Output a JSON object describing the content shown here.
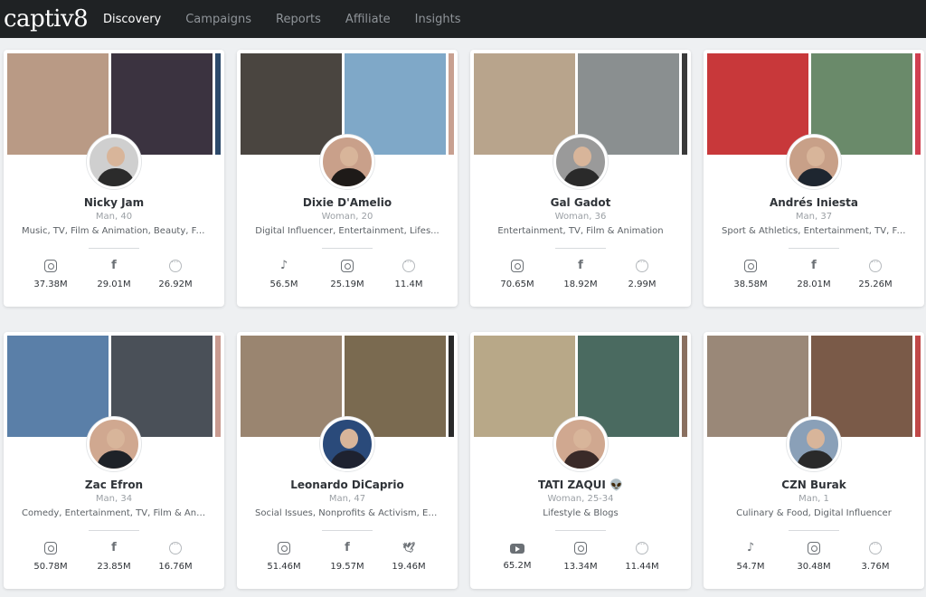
{
  "app": {
    "logo": "captiv8"
  },
  "nav": {
    "items": [
      {
        "label": "Discovery",
        "active": true
      },
      {
        "label": "Campaigns",
        "active": false
      },
      {
        "label": "Reports",
        "active": false
      },
      {
        "label": "Affiliate",
        "active": false
      },
      {
        "label": "Insights",
        "active": false
      }
    ]
  },
  "colors": {
    "navbar": "#1f2224",
    "background": "#eef0f2",
    "card": "#ffffff",
    "icon": "#6b7075"
  },
  "influencers": [
    {
      "name": "Nicky Jam",
      "meta": "Man, 40",
      "categories": "Music, TV, Film & Animation, Beauty, Fa...",
      "photo_colors": [
        "#b99a85",
        "#3b3340",
        "#2d4a6b"
      ],
      "avatar_colors": [
        "#cfcfcf",
        "#2b2b2b"
      ],
      "stats": [
        {
          "icon": "instagram-icon",
          "value": "37.38M"
        },
        {
          "icon": "facebook-icon",
          "value": "29.01M"
        },
        {
          "icon": "more-icon",
          "value": "26.92M"
        }
      ]
    },
    {
      "name": "Dixie D'Amelio",
      "meta": "Woman, 20",
      "categories": "Digital Influencer, Entertainment, Lifes...",
      "photo_colors": [
        "#4a4540",
        "#7fa8c8",
        "#c8a090"
      ],
      "avatar_colors": [
        "#c9a08a",
        "#1e1a18"
      ],
      "stats": [
        {
          "icon": "tiktok-icon",
          "value": "56.5M"
        },
        {
          "icon": "instagram-icon",
          "value": "25.19M"
        },
        {
          "icon": "more-icon",
          "value": "11.4M"
        }
      ]
    },
    {
      "name": "Gal Gadot",
      "meta": "Woman, 36",
      "categories": "Entertainment, TV, Film & Animation",
      "photo_colors": [
        "#b8a48c",
        "#8a8f90",
        "#3a3a3a"
      ],
      "avatar_colors": [
        "#9a9a9a",
        "#2a2a2a"
      ],
      "stats": [
        {
          "icon": "instagram-icon",
          "value": "70.65M"
        },
        {
          "icon": "facebook-icon",
          "value": "18.92M"
        },
        {
          "icon": "more-icon",
          "value": "2.99M"
        }
      ]
    },
    {
      "name": "Andrés Iniesta",
      "meta": "Man, 37",
      "categories": "Sport & Athletics, Entertainment, TV, Fil...",
      "photo_colors": [
        "#c8383a",
        "#6a8a6a",
        "#d04050"
      ],
      "avatar_colors": [
        "#c8a088",
        "#1e2630"
      ],
      "stats": [
        {
          "icon": "instagram-icon",
          "value": "38.58M"
        },
        {
          "icon": "facebook-icon",
          "value": "28.01M"
        },
        {
          "icon": "more-icon",
          "value": "25.26M"
        }
      ]
    },
    {
      "name": "Zac Efron",
      "meta": "Man, 34",
      "categories": "Comedy, Entertainment, TV, Film & Anim...",
      "photo_colors": [
        "#5a7fa8",
        "#4a5058",
        "#c89a90"
      ],
      "avatar_colors": [
        "#d0a890",
        "#1e2228"
      ],
      "stats": [
        {
          "icon": "instagram-icon",
          "value": "50.78M"
        },
        {
          "icon": "facebook-icon",
          "value": "23.85M"
        },
        {
          "icon": "more-icon",
          "value": "16.76M"
        }
      ]
    },
    {
      "name": "Leonardo DiCaprio",
      "meta": "Man, 47",
      "categories": "Social Issues, Nonprofits & Activism, Ent...",
      "photo_colors": [
        "#9a8570",
        "#7a6a50",
        "#2a2a2a"
      ],
      "avatar_colors": [
        "#2a4a7a",
        "#1e2230"
      ],
      "stats": [
        {
          "icon": "instagram-icon",
          "value": "51.46M"
        },
        {
          "icon": "facebook-icon",
          "value": "19.57M"
        },
        {
          "icon": "twitter-icon",
          "value": "19.46M"
        }
      ]
    },
    {
      "name": "TATI ZAQUI 👽",
      "meta": "Woman, 25-34",
      "categories": "Lifestyle & Blogs",
      "photo_colors": [
        "#b8a888",
        "#4a6a60",
        "#8a7060"
      ],
      "avatar_colors": [
        "#d0a890",
        "#3a2a28"
      ],
      "stats": [
        {
          "icon": "youtube-icon",
          "value": "65.2M"
        },
        {
          "icon": "instagram-icon",
          "value": "13.34M"
        },
        {
          "icon": "more-icon",
          "value": "11.44M"
        }
      ]
    },
    {
      "name": "CZN Burak",
      "meta": "Man, 1",
      "categories": "Culinary & Food, Digital Influencer",
      "photo_colors": [
        "#9a8878",
        "#7a5a48",
        "#c04848"
      ],
      "avatar_colors": [
        "#8aa0b8",
        "#2a2a2a"
      ],
      "stats": [
        {
          "icon": "tiktok-icon",
          "value": "54.7M"
        },
        {
          "icon": "instagram-icon",
          "value": "30.48M"
        },
        {
          "icon": "more-icon",
          "value": "3.76M"
        }
      ]
    }
  ]
}
